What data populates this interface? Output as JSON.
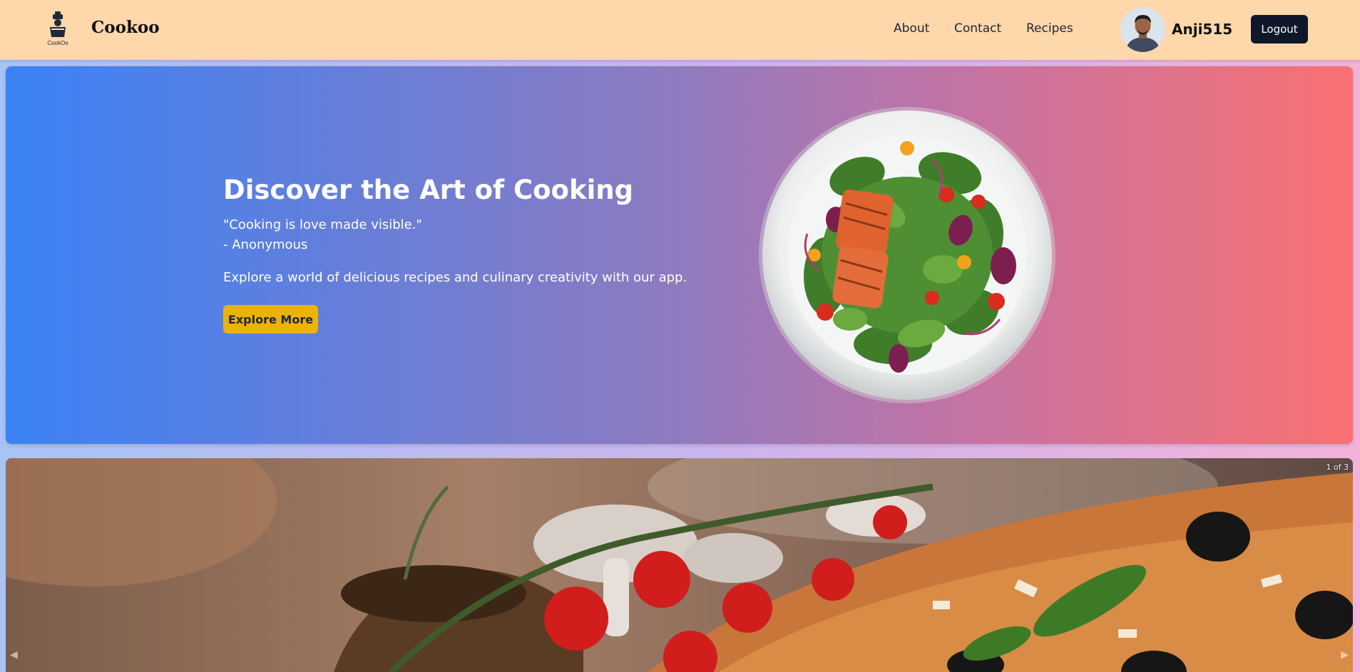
{
  "navbar": {
    "brand": "Cookoo",
    "logo_text": "CookOo",
    "links": [
      "About",
      "Contact",
      "Recipes"
    ],
    "username": "Anji515",
    "logout_label": "Logout"
  },
  "hero": {
    "title": "Discover the Art of Cooking",
    "quote": "\"Cooking is love made visible.\"",
    "quote_author": "- Anonymous",
    "tagline": "Explore a world of delicious recipes and culinary creativity with our app.",
    "cta_label": "Explore More",
    "image": "salmon-salad-plate"
  },
  "carousel": {
    "counter": "1 of 3",
    "image": "pizza-closeup",
    "prev_icon": "arrow-left-icon",
    "next_icon": "arrow-right-icon"
  },
  "colors": {
    "navbar_bg": "#fed7aa",
    "hero_gradient_start": "#3b82f6",
    "hero_gradient_end": "#f87171",
    "cta_bg": "#eab308",
    "logout_bg": "#0f172a"
  }
}
